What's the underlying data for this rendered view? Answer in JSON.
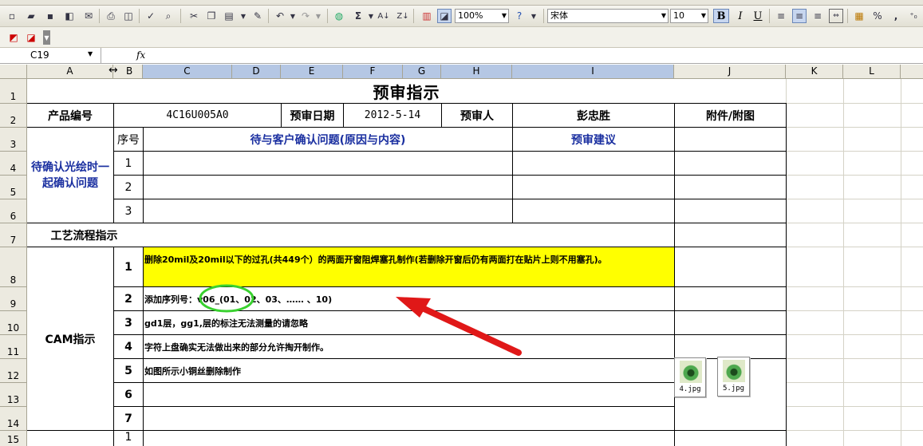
{
  "toolbar": {
    "zoom": "100%",
    "font_name": "宋体",
    "font_size": "10",
    "bold_label": "B",
    "italic_label": "I",
    "underline_label": "U",
    "percent_label": "%",
    "comma_label": ","
  },
  "formula_bar": {
    "name_box": "C19",
    "fx_label": "fx",
    "formula": ""
  },
  "columns": [
    "A",
    "B",
    "C",
    "D",
    "E",
    "F",
    "G",
    "H",
    "I",
    "J",
    "K",
    "L"
  ],
  "rows": [
    "1",
    "2",
    "3",
    "4",
    "5",
    "6",
    "7",
    "8",
    "9",
    "10",
    "11",
    "12",
    "13",
    "14",
    "15"
  ],
  "sheet": {
    "title": "预审指示",
    "product_no_label": "产品编号",
    "product_no": "4C16U005A0",
    "review_date_label": "预审日期",
    "review_date": "2012-5-14",
    "reviewer_label": "预审人",
    "reviewer": "彭忠胜",
    "attachment_label": "附件/附图",
    "seq_label": "序号",
    "issues_label": "待与客户确认问题(原因与内容)",
    "advice_label": "预审建议",
    "pending_label": "待确认光绘时一起确认问题",
    "pending_seq": [
      "1",
      "2",
      "3"
    ],
    "process_label": "工艺流程指示",
    "cam_label": "CAM指示",
    "cam_seq": [
      "1",
      "2",
      "3",
      "4",
      "5",
      "6",
      "7"
    ],
    "cam_items": [
      "删除20mil及20mil以下的过孔(共449个）的两面开窗阻焊塞孔制作(若删除开窗后仍有两面打在贴片上则不用塞孔)。",
      "添加序列号：v06_(01、02、03、…… 、10)",
      "gd1层，gg1,层的标注无法测量的请忽略",
      "字符上盘确实无法做出来的部分允许掏开制作。",
      "如图所示小铜丝删除制作",
      "",
      ""
    ],
    "last_seq": "1"
  },
  "attachments": [
    {
      "label": "4.jpg"
    },
    {
      "label": "5.jpg"
    }
  ],
  "colors": {
    "highlight": "#ffff00",
    "blue_text": "#1a2fa0",
    "arrow": "#e01818",
    "circle": "#39d12f"
  }
}
